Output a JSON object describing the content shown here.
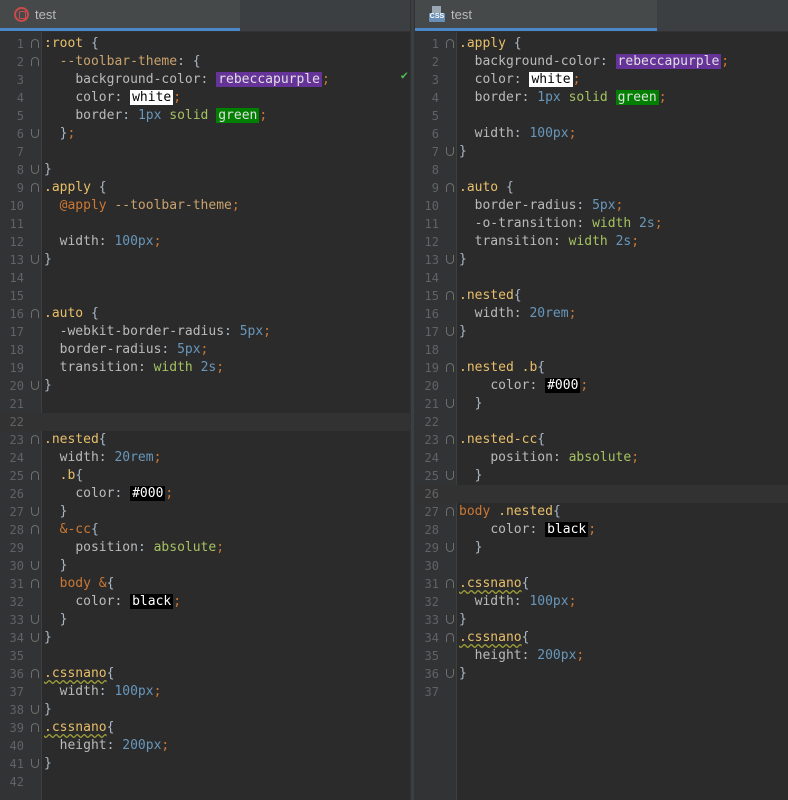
{
  "left": {
    "tab_title": "test",
    "lines": [
      {
        "n": "1",
        "fold": "open",
        "tokens": [
          [
            "sel",
            ":root"
          ],
          [
            "plain",
            " {"
          ]
        ]
      },
      {
        "n": "2",
        "fold": "open",
        "tokens": [
          [
            "plain",
            "  "
          ],
          [
            "var",
            "--toolbar-theme"
          ],
          [
            "plain",
            ": {"
          ]
        ]
      },
      {
        "n": "3",
        "tokens": [
          [
            "plain",
            "    "
          ],
          [
            "prop",
            "background-color"
          ],
          [
            "plain",
            ": "
          ],
          [
            "sw-rebecca",
            "rebeccapurple"
          ],
          [
            "punc",
            ";"
          ]
        ]
      },
      {
        "n": "4",
        "tokens": [
          [
            "plain",
            "    "
          ],
          [
            "prop",
            "color"
          ],
          [
            "plain",
            ": "
          ],
          [
            "sw-white",
            "white"
          ],
          [
            "punc",
            ";"
          ]
        ]
      },
      {
        "n": "5",
        "tokens": [
          [
            "plain",
            "    "
          ],
          [
            "prop",
            "border"
          ],
          [
            "plain",
            ": "
          ],
          [
            "num",
            "1px"
          ],
          [
            "plain",
            " "
          ],
          [
            "val",
            "solid"
          ],
          [
            "plain",
            " "
          ],
          [
            "sw-green",
            "green"
          ],
          [
            "punc",
            ";"
          ]
        ]
      },
      {
        "n": "6",
        "fold": "close",
        "tokens": [
          [
            "plain",
            "  }"
          ],
          [
            "punc",
            ";"
          ]
        ]
      },
      {
        "n": "7",
        "tokens": []
      },
      {
        "n": "8",
        "fold": "close",
        "tokens": [
          [
            "plain",
            "}"
          ]
        ]
      },
      {
        "n": "9",
        "fold": "open",
        "tokens": [
          [
            "sel",
            ".apply"
          ],
          [
            "plain",
            " {"
          ]
        ]
      },
      {
        "n": "10",
        "tokens": [
          [
            "plain",
            "  "
          ],
          [
            "at",
            "@apply"
          ],
          [
            "plain",
            " "
          ],
          [
            "var",
            "--toolbar-theme"
          ],
          [
            "punc",
            ";"
          ]
        ]
      },
      {
        "n": "11",
        "tokens": []
      },
      {
        "n": "12",
        "tokens": [
          [
            "plain",
            "  "
          ],
          [
            "prop",
            "width"
          ],
          [
            "plain",
            ": "
          ],
          [
            "num",
            "100px"
          ],
          [
            "punc",
            ";"
          ]
        ]
      },
      {
        "n": "13",
        "fold": "close",
        "tokens": [
          [
            "plain",
            "}"
          ]
        ]
      },
      {
        "n": "14",
        "tokens": []
      },
      {
        "n": "15",
        "tokens": []
      },
      {
        "n": "16",
        "fold": "open",
        "tokens": [
          [
            "sel",
            ".auto"
          ],
          [
            "plain",
            " {"
          ]
        ]
      },
      {
        "n": "17",
        "tokens": [
          [
            "plain",
            "  "
          ],
          [
            "prop",
            "-webkit-border-radius"
          ],
          [
            "plain",
            ": "
          ],
          [
            "num",
            "5px"
          ],
          [
            "punc",
            ";"
          ]
        ]
      },
      {
        "n": "18",
        "tokens": [
          [
            "plain",
            "  "
          ],
          [
            "prop",
            "border-radius"
          ],
          [
            "plain",
            ": "
          ],
          [
            "num",
            "5px"
          ],
          [
            "punc",
            ";"
          ]
        ]
      },
      {
        "n": "19",
        "tokens": [
          [
            "plain",
            "  "
          ],
          [
            "prop",
            "transition"
          ],
          [
            "plain",
            ": "
          ],
          [
            "val",
            "width"
          ],
          [
            "plain",
            " "
          ],
          [
            "num",
            "2s"
          ],
          [
            "punc",
            ";"
          ]
        ]
      },
      {
        "n": "20",
        "fold": "close",
        "tokens": [
          [
            "plain",
            "}"
          ]
        ]
      },
      {
        "n": "21",
        "tokens": []
      },
      {
        "n": "22",
        "current": true,
        "tokens": []
      },
      {
        "n": "23",
        "fold": "open",
        "tokens": [
          [
            "sel",
            ".nested"
          ],
          [
            "plain",
            "{"
          ]
        ]
      },
      {
        "n": "24",
        "tokens": [
          [
            "plain",
            "  "
          ],
          [
            "prop",
            "width"
          ],
          [
            "plain",
            ": "
          ],
          [
            "num",
            "20rem"
          ],
          [
            "punc",
            ";"
          ]
        ]
      },
      {
        "n": "25",
        "fold": "open",
        "tokens": [
          [
            "plain",
            "  "
          ],
          [
            "sel",
            ".b"
          ],
          [
            "plain",
            "{"
          ]
        ]
      },
      {
        "n": "26",
        "tokens": [
          [
            "plain",
            "    "
          ],
          [
            "prop",
            "color"
          ],
          [
            "plain",
            ": "
          ],
          [
            "sw-black",
            "#000"
          ],
          [
            "punc",
            ";"
          ]
        ]
      },
      {
        "n": "27",
        "fold": "close",
        "tokens": [
          [
            "plain",
            "  }"
          ]
        ]
      },
      {
        "n": "28",
        "fold": "open",
        "tokens": [
          [
            "plain",
            "  "
          ],
          [
            "at",
            "&-cc"
          ],
          [
            "plain",
            "{"
          ]
        ]
      },
      {
        "n": "29",
        "tokens": [
          [
            "plain",
            "    "
          ],
          [
            "prop",
            "position"
          ],
          [
            "plain",
            ": "
          ],
          [
            "val",
            "absolute"
          ],
          [
            "punc",
            ";"
          ]
        ]
      },
      {
        "n": "30",
        "fold": "close",
        "tokens": [
          [
            "plain",
            "  }"
          ]
        ]
      },
      {
        "n": "31",
        "fold": "open",
        "tokens": [
          [
            "plain",
            "  "
          ],
          [
            "at",
            "body"
          ],
          [
            "plain",
            " "
          ],
          [
            "at",
            "&"
          ],
          [
            "plain",
            "{"
          ]
        ]
      },
      {
        "n": "32",
        "tokens": [
          [
            "plain",
            "    "
          ],
          [
            "prop",
            "color"
          ],
          [
            "plain",
            ": "
          ],
          [
            "sw-black",
            "black"
          ],
          [
            "punc",
            ";"
          ]
        ]
      },
      {
        "n": "33",
        "fold": "close",
        "tokens": [
          [
            "plain",
            "  }"
          ]
        ]
      },
      {
        "n": "34",
        "fold": "close",
        "tokens": [
          [
            "plain",
            "}"
          ]
        ]
      },
      {
        "n": "35",
        "tokens": []
      },
      {
        "n": "36",
        "fold": "open",
        "tokens": [
          [
            "sel",
            ".cssnano",
            "wavy"
          ],
          [
            "plain",
            "{"
          ]
        ]
      },
      {
        "n": "37",
        "tokens": [
          [
            "plain",
            "  "
          ],
          [
            "prop",
            "width"
          ],
          [
            "plain",
            ": "
          ],
          [
            "num",
            "100px"
          ],
          [
            "punc",
            ";"
          ]
        ]
      },
      {
        "n": "38",
        "fold": "close",
        "tokens": [
          [
            "plain",
            "}"
          ]
        ]
      },
      {
        "n": "39",
        "fold": "open",
        "tokens": [
          [
            "sel",
            ".cssnano",
            "wavy"
          ],
          [
            "plain",
            "{"
          ]
        ]
      },
      {
        "n": "40",
        "tokens": [
          [
            "plain",
            "  "
          ],
          [
            "prop",
            "height"
          ],
          [
            "plain",
            ": "
          ],
          [
            "num",
            "200px"
          ],
          [
            "punc",
            ";"
          ]
        ]
      },
      {
        "n": "41",
        "fold": "close",
        "tokens": [
          [
            "plain",
            "}"
          ]
        ]
      },
      {
        "n": "42",
        "tokens": []
      }
    ]
  },
  "right": {
    "tab_title": "test",
    "tab_icon_text": "CSS",
    "lines": [
      {
        "n": "1",
        "fold": "open",
        "tokens": [
          [
            "sel",
            ".apply"
          ],
          [
            "plain",
            " {"
          ]
        ]
      },
      {
        "n": "2",
        "tokens": [
          [
            "plain",
            "  "
          ],
          [
            "prop",
            "background-color"
          ],
          [
            "plain",
            ": "
          ],
          [
            "sw-rebecca",
            "rebeccapurple"
          ],
          [
            "punc",
            ";"
          ]
        ]
      },
      {
        "n": "3",
        "tokens": [
          [
            "plain",
            "  "
          ],
          [
            "prop",
            "color"
          ],
          [
            "plain",
            ": "
          ],
          [
            "sw-white",
            "white"
          ],
          [
            "punc",
            ";"
          ]
        ]
      },
      {
        "n": "4",
        "tokens": [
          [
            "plain",
            "  "
          ],
          [
            "prop",
            "border"
          ],
          [
            "plain",
            ": "
          ],
          [
            "num",
            "1px"
          ],
          [
            "plain",
            " "
          ],
          [
            "val",
            "solid"
          ],
          [
            "plain",
            " "
          ],
          [
            "sw-green",
            "green"
          ],
          [
            "punc",
            ";"
          ]
        ]
      },
      {
        "n": "5",
        "tokens": []
      },
      {
        "n": "6",
        "tokens": [
          [
            "plain",
            "  "
          ],
          [
            "prop",
            "width"
          ],
          [
            "plain",
            ": "
          ],
          [
            "num",
            "100px"
          ],
          [
            "punc",
            ";"
          ]
        ]
      },
      {
        "n": "7",
        "fold": "close",
        "tokens": [
          [
            "plain",
            "}"
          ]
        ]
      },
      {
        "n": "8",
        "tokens": []
      },
      {
        "n": "9",
        "fold": "open",
        "tokens": [
          [
            "sel",
            ".auto"
          ],
          [
            "plain",
            " {"
          ]
        ]
      },
      {
        "n": "10",
        "tokens": [
          [
            "plain",
            "  "
          ],
          [
            "prop",
            "border-radius"
          ],
          [
            "plain",
            ": "
          ],
          [
            "num",
            "5px"
          ],
          [
            "punc",
            ";"
          ]
        ]
      },
      {
        "n": "11",
        "tokens": [
          [
            "plain",
            "  "
          ],
          [
            "prop",
            "-o-transition"
          ],
          [
            "plain",
            ": "
          ],
          [
            "val",
            "width"
          ],
          [
            "plain",
            " "
          ],
          [
            "num",
            "2s"
          ],
          [
            "punc",
            ";"
          ]
        ]
      },
      {
        "n": "12",
        "tokens": [
          [
            "plain",
            "  "
          ],
          [
            "prop",
            "transition"
          ],
          [
            "plain",
            ": "
          ],
          [
            "val",
            "width"
          ],
          [
            "plain",
            " "
          ],
          [
            "num",
            "2s"
          ],
          [
            "punc",
            ";"
          ]
        ]
      },
      {
        "n": "13",
        "fold": "close",
        "tokens": [
          [
            "plain",
            "}"
          ]
        ]
      },
      {
        "n": "14",
        "tokens": []
      },
      {
        "n": "15",
        "fold": "open",
        "tokens": [
          [
            "sel",
            ".nested"
          ],
          [
            "plain",
            "{"
          ]
        ]
      },
      {
        "n": "16",
        "tokens": [
          [
            "plain",
            "  "
          ],
          [
            "prop",
            "width"
          ],
          [
            "plain",
            ": "
          ],
          [
            "num",
            "20rem"
          ],
          [
            "punc",
            ";"
          ]
        ]
      },
      {
        "n": "17",
        "fold": "close",
        "tokens": [
          [
            "plain",
            "}"
          ]
        ]
      },
      {
        "n": "18",
        "tokens": []
      },
      {
        "n": "19",
        "fold": "open",
        "tokens": [
          [
            "sel",
            ".nested .b"
          ],
          [
            "plain",
            "{"
          ]
        ]
      },
      {
        "n": "20",
        "tokens": [
          [
            "plain",
            "    "
          ],
          [
            "prop",
            "color"
          ],
          [
            "plain",
            ": "
          ],
          [
            "sw-black",
            "#000"
          ],
          [
            "punc",
            ";"
          ]
        ]
      },
      {
        "n": "21",
        "fold": "close",
        "tokens": [
          [
            "plain",
            "  }"
          ]
        ]
      },
      {
        "n": "22",
        "tokens": []
      },
      {
        "n": "23",
        "fold": "open",
        "tokens": [
          [
            "sel",
            ".nested-cc"
          ],
          [
            "plain",
            "{"
          ]
        ]
      },
      {
        "n": "24",
        "tokens": [
          [
            "plain",
            "    "
          ],
          [
            "prop",
            "position"
          ],
          [
            "plain",
            ": "
          ],
          [
            "val",
            "absolute"
          ],
          [
            "punc",
            ";"
          ]
        ]
      },
      {
        "n": "25",
        "fold": "close",
        "tokens": [
          [
            "plain",
            "  }"
          ]
        ]
      },
      {
        "n": "26",
        "current": true,
        "tokens": []
      },
      {
        "n": "27",
        "fold": "open",
        "tokens": [
          [
            "at",
            "body"
          ],
          [
            "plain",
            " "
          ],
          [
            "sel",
            ".nested"
          ],
          [
            "plain",
            "{"
          ]
        ]
      },
      {
        "n": "28",
        "tokens": [
          [
            "plain",
            "    "
          ],
          [
            "prop",
            "color"
          ],
          [
            "plain",
            ": "
          ],
          [
            "sw-black",
            "black"
          ],
          [
            "punc",
            ";"
          ]
        ]
      },
      {
        "n": "29",
        "fold": "close",
        "tokens": [
          [
            "plain",
            "  }"
          ]
        ]
      },
      {
        "n": "30",
        "tokens": []
      },
      {
        "n": "31",
        "fold": "open",
        "tokens": [
          [
            "sel",
            ".cssnano",
            "wavy"
          ],
          [
            "plain",
            "{"
          ]
        ]
      },
      {
        "n": "32",
        "tokens": [
          [
            "plain",
            "  "
          ],
          [
            "prop",
            "width"
          ],
          [
            "plain",
            ": "
          ],
          [
            "num",
            "100px"
          ],
          [
            "punc",
            ";"
          ]
        ]
      },
      {
        "n": "33",
        "fold": "close",
        "tokens": [
          [
            "plain",
            "}"
          ]
        ]
      },
      {
        "n": "34",
        "fold": "open",
        "tokens": [
          [
            "sel",
            ".cssnano",
            "wavy"
          ],
          [
            "plain",
            "{"
          ]
        ]
      },
      {
        "n": "35",
        "tokens": [
          [
            "plain",
            "  "
          ],
          [
            "prop",
            "height"
          ],
          [
            "plain",
            ": "
          ],
          [
            "num",
            "200px"
          ],
          [
            "punc",
            ";"
          ]
        ]
      },
      {
        "n": "36",
        "fold": "close",
        "tokens": [
          [
            "plain",
            "}"
          ]
        ]
      },
      {
        "n": "37",
        "tokens": []
      }
    ]
  },
  "inspection_status": "✔"
}
